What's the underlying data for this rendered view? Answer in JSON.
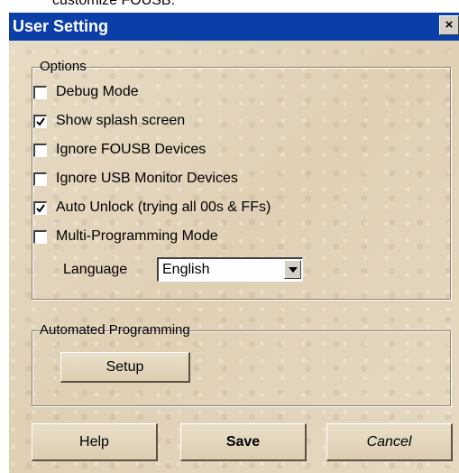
{
  "background_fragment": "customize FOUSB.",
  "window": {
    "title": "User Setting",
    "close_glyph": "×"
  },
  "options": {
    "group_label": "Options",
    "items": [
      {
        "label": "Debug Mode",
        "checked": false
      },
      {
        "label": "Show splash screen",
        "checked": true
      },
      {
        "label": "Ignore FOUSB Devices",
        "checked": false
      },
      {
        "label": "Ignore USB Monitor Devices",
        "checked": false
      },
      {
        "label": "Auto Unlock (trying all 00s & FFs)",
        "checked": true
      },
      {
        "label": "Multi-Programming Mode",
        "checked": false
      }
    ],
    "language_label": "Language",
    "language_value": "English"
  },
  "automated": {
    "group_label": "Automated Programming",
    "setup_label": "Setup"
  },
  "buttons": {
    "help": "Help",
    "save": "Save",
    "cancel": "Cancel"
  },
  "colors": {
    "titlebar": "#0b3fa8",
    "dialog_bg": "#e4d7bf"
  }
}
